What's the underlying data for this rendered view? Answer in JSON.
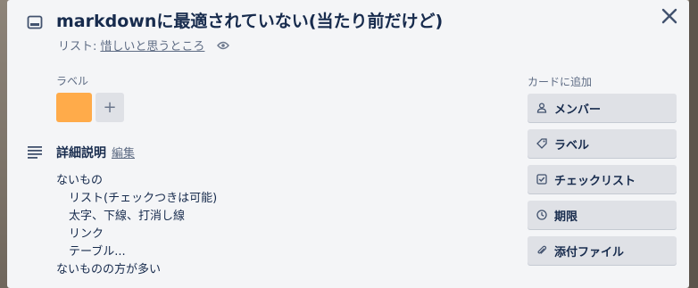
{
  "card": {
    "title": "markdownに最適されていない(当たり前だけど)",
    "list_prefix": "リスト: ",
    "list_name": "惜しいと思うところ"
  },
  "labels": {
    "heading": "ラベル",
    "items": [
      {
        "color": "#ffab4a"
      }
    ],
    "add_symbol": "+"
  },
  "description": {
    "heading": "詳細説明",
    "edit_label": "編集",
    "lines": [
      "ないもの",
      "リスト(チェックつきは可能)",
      "太字、下線、打消し線",
      "リンク",
      "テーブル...",
      "ないものの方が多い"
    ]
  },
  "sidebar": {
    "heading": "カードに追加",
    "buttons": [
      {
        "label": "メンバー",
        "icon": "person-icon"
      },
      {
        "label": "ラベル",
        "icon": "tag-icon"
      },
      {
        "label": "チェックリスト",
        "icon": "checkbox-icon"
      },
      {
        "label": "期限",
        "icon": "clock-icon"
      },
      {
        "label": "添付ファイル",
        "icon": "paperclip-icon"
      }
    ]
  },
  "colors": {
    "label_orange": "#ffab4a",
    "text_primary": "#172b4d",
    "text_secondary": "#5e6c84",
    "button_bg": "#dfe1e6",
    "modal_bg": "#f4f5f7"
  }
}
